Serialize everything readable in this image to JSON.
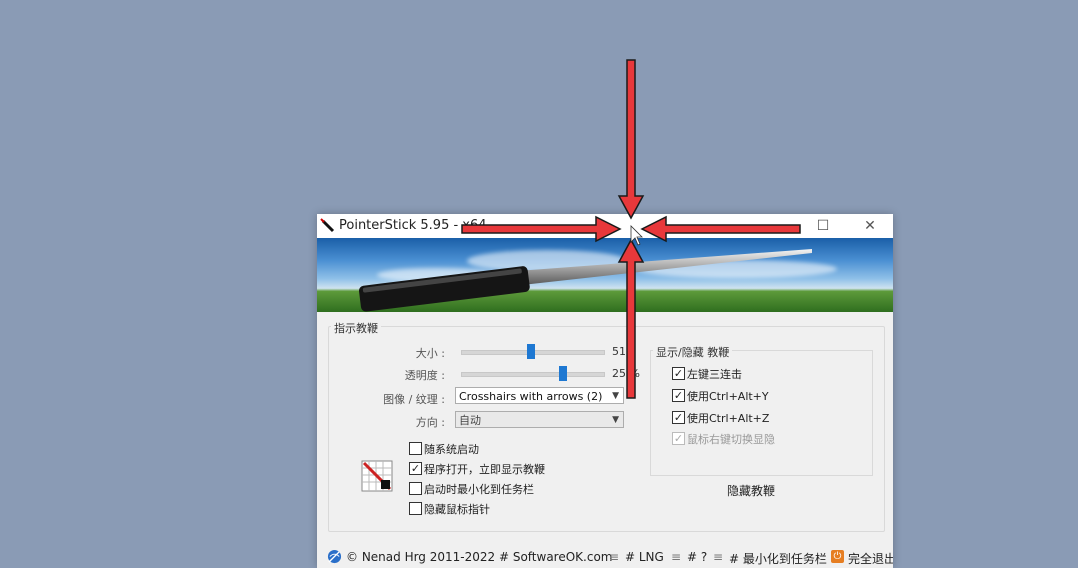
{
  "window": {
    "title": "PointerStick 5.95 - x64",
    "maximize_symbol": "☐",
    "close_symbol": "✕"
  },
  "settings": {
    "group_label": "指示教鞭",
    "size_label": "大小 :",
    "size_value": "512",
    "size_fraction": 0.49,
    "opacity_label": "透明度 :",
    "opacity_value": "25 %",
    "opacity_fraction": 0.72,
    "image_label": "图像 / 纹理 :",
    "image_value": "Crosshairs with arrows (2)",
    "direction_label": "方向 :",
    "direction_value": "自动",
    "checkboxes": [
      {
        "label": "随系统启动",
        "checked": false
      },
      {
        "label": "程序打开，立即显示教鞭",
        "checked": true
      },
      {
        "label": "启动时最小化到任务栏",
        "checked": false
      },
      {
        "label": "隐藏鼠标指针",
        "checked": false
      }
    ]
  },
  "showhide": {
    "group_label": "显示/隐藏 教鞭",
    "options": [
      {
        "label": "左键三连击",
        "checked": true,
        "disabled": false
      },
      {
        "label": "使用Ctrl+Alt+Y",
        "checked": true,
        "disabled": false
      },
      {
        "label": "使用Ctrl+Alt+Z",
        "checked": true,
        "disabled": false
      },
      {
        "label": "鼠标右键切换显隐",
        "checked": true,
        "disabled": true
      }
    ],
    "hide_button": "隐藏教鞭"
  },
  "statusbar": {
    "copyright": "© Nenad Hrg 2011-2022 # SoftwareOK.com",
    "lng": "# LNG",
    "help": "# ?",
    "minimize": "# 最小化到任务栏",
    "exit": "完全退出"
  },
  "colors": {
    "desktop": "#8a9bb5",
    "accent": "#1e78d2",
    "arrow_red": "#e8383b"
  },
  "icons": {
    "app": "pointer-stick-icon",
    "grid": "grid-image-icon",
    "arrows": "crosshair-arrows-overlay"
  }
}
